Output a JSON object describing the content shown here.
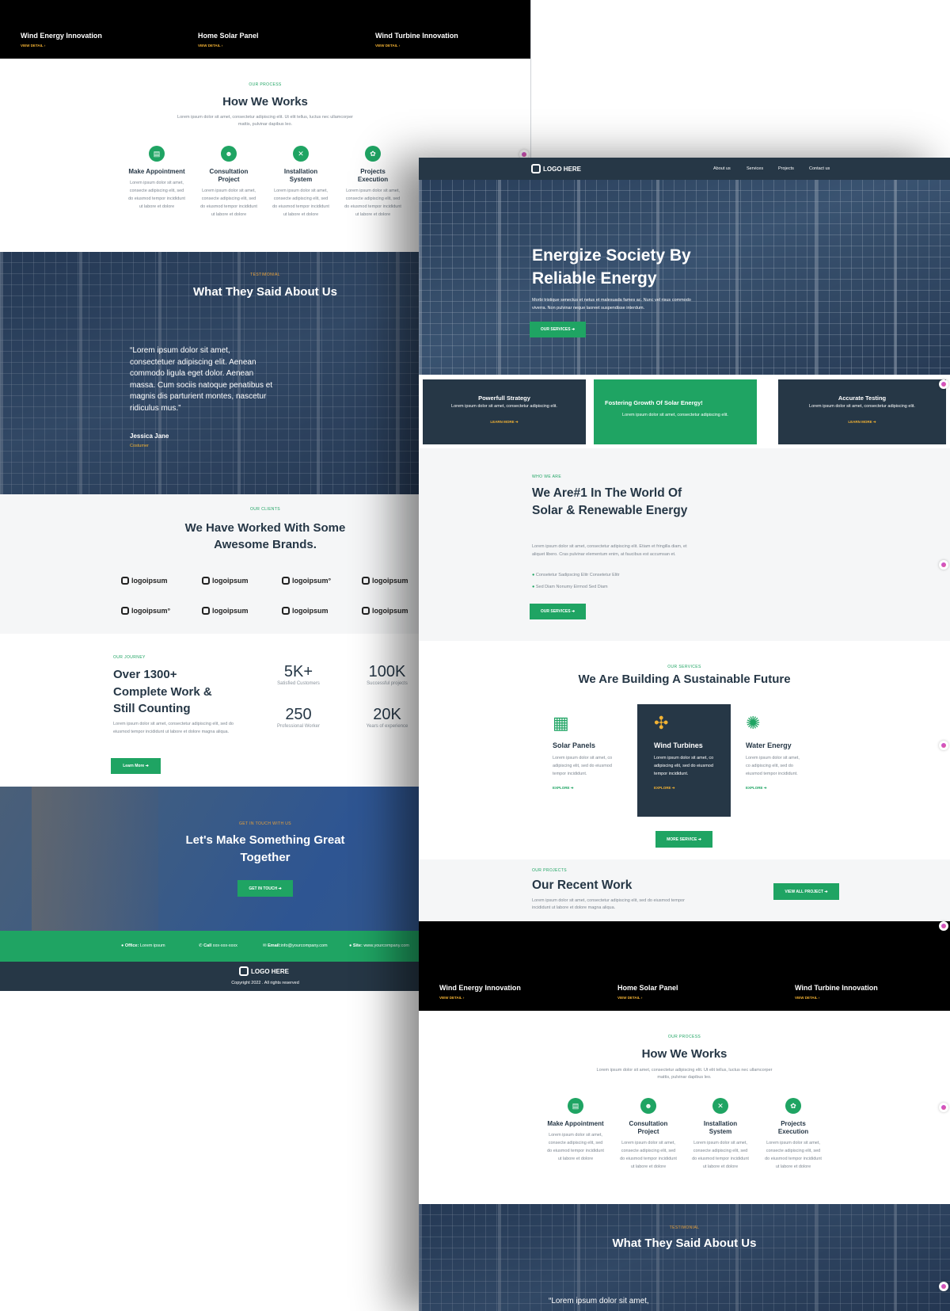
{
  "projects": [
    {
      "title": "Wind Energy Innovation",
      "link": "VIEW DETAIL ›"
    },
    {
      "title": "Home Solar Panel",
      "link": "VIEW DETAIL ›"
    },
    {
      "title": "Wind Turbine Innovation",
      "link": "VIEW DETAIL ›"
    }
  ],
  "process": {
    "eyebrow": "OUR PROCESS",
    "title": "How We Works",
    "desc": "Lorem ipsum dolor sit amet, consectetur adipiscing elit. Ut elit tellus, luctus nec ullamcorper mattis, pulvinar dapibus leo.",
    "steps": [
      {
        "icon": "calendar-icon",
        "glyph": "▤",
        "title": "Make Appointment",
        "desc": "Lorem ipsum dolor sit amet, consecte adipiscing elit, sed do eiusmod tempor incididunt ut labore et dolore"
      },
      {
        "icon": "users-icon",
        "glyph": "☻",
        "title": "Consultation Project",
        "desc": "Lorem ipsum dolor sit amet, consecte adipiscing elit, sed do eiusmod tempor incididunt ut labore et dolore"
      },
      {
        "icon": "tools-icon",
        "glyph": "✕",
        "title": "Installation System",
        "desc": "Lorem ipsum dolor sit amet, consecte adipiscing elit, sed do eiusmod tempor incididunt ut labore et dolore"
      },
      {
        "icon": "hand-plant-icon",
        "glyph": "✿",
        "title": "Projects Execution",
        "desc": "Lorem ipsum dolor sit amet, consecte adipiscing elit, sed do eiusmod tempor incididunt ut labore et dolore"
      }
    ]
  },
  "testimonial": {
    "eyebrow": "TESTIMONIAL",
    "title": "What They Said About Us",
    "quote": "“Lorem ipsum dolor sit amet, consectetuer adipiscing elit. Aenean commodo ligula eget dolor. Aenean massa. Cum sociis natoque penatibus et magnis dis parturient montes, nascetur ridiculus mus.”",
    "quote_short": "“Lorem ipsum dolor sit amet,",
    "name": "Jessica Jane",
    "role": "Costumer"
  },
  "clients": {
    "eyebrow": "OUR CLIENTS",
    "title": "We Have Worked With Some Awesome Brands.",
    "logos": [
      "logoipsum",
      "logoipsum",
      "logoipsum°",
      "logoipsum",
      "logoipsum°",
      "logoipsum",
      "logoipsum",
      "logoipsum"
    ]
  },
  "journey": {
    "eyebrow": "OUR JOURNEY",
    "title": "Over 1300+ Complete Work & Still Counting",
    "desc": "Lorem ipsum dolor sit amet, consectetur adipiscing elit, sed do eiusmod tempor incididunt ut labore et dolore magna aliqua.",
    "button": "Learn More ➔",
    "stats": [
      {
        "value": "5K+",
        "label": "Satisfied Customers"
      },
      {
        "value": "100K",
        "label": "Successful projects"
      },
      {
        "value": "250",
        "label": "Professional Worker"
      },
      {
        "value": "20K",
        "label": "Years of experience"
      }
    ]
  },
  "contact_cta": {
    "eyebrow": "GET IN TOUCH WITH US",
    "title": "Let's Make Something Great Together",
    "button": "GET IN TOUCH ➔"
  },
  "contact_bar": [
    {
      "label": "Office:",
      "value": "Lorem ipsum"
    },
    {
      "label": "Call",
      "value": "xxx-xxx-xxxx"
    },
    {
      "label": "Email:",
      "value": "info@yourcompany.com"
    },
    {
      "label": "Site:",
      "value": "www.yourcompany.com"
    }
  ],
  "footer": {
    "logo": "LOGO HERE",
    "copyright": "Copyright 2022 . All rights reserved"
  },
  "nav": {
    "logo": "LOGO HERE",
    "links": [
      "About us",
      "Services",
      "Projects",
      "Contact us"
    ]
  },
  "hero": {
    "title": "Energize Society By Reliable Energy",
    "desc": "Morbi tristique senectus et netus et malesuada fames ac. Nunc vel risus commodo viverra. Non pulvinar neque laoreet suspendisse interdum.",
    "button": "OUR SERVICES ➔"
  },
  "features": [
    {
      "title": "Powerfull Strategy",
      "desc": "Lorem ipsum dolor sit amet, consectetur adipiscing elit.",
      "link": "LEARN MORE ➔"
    },
    {
      "title": "Fostering Growth Of Solar Energy!",
      "desc": "Lorem ipsum dolor sit amet, consectetur adipiscing elit."
    },
    {
      "title": "Accurate Testing",
      "desc": "Lorem ipsum dolor sit amet, consectetur adipiscing elit.",
      "link": "LEARN MORE ➔"
    }
  ],
  "about": {
    "eyebrow": "WHO WE ARE",
    "title": "We Are#1 In The World Of Solar & Renewable Energy",
    "desc": "Lorem ipsum dolor sit amet, consectetur adipiscing elit. Etiam et fringilla diam, et aliquet libero. Cras pulvinar elementum enim, at faucibus est accumsan et.",
    "checks": [
      "Consetetur Sadipscing Elitr Consetetur Elitr",
      "Sed Diam Nonumy Eirmod Sed Diam"
    ],
    "button": "OUR SERVICES ➔"
  },
  "services": {
    "eyebrow": "OUR SERVICES",
    "title": "We Are Building A Sustainable Future",
    "items": [
      {
        "icon": "solar-panel-icon",
        "glyph": "▦",
        "title": "Solar Panels",
        "desc": "Lorem ipsum dolor sit amet, co adipiscing elit, sed do eiusmod tempor incididunt.",
        "link": "EXPLORE ➔"
      },
      {
        "icon": "windmill-icon",
        "glyph": "✣",
        "title": "Wind Turbines",
        "desc": "Lorem ipsum dolor sit amet, co adipiscing elit, sed do eiusmod tempor incididunt.",
        "link": "EXPLORE ➔"
      },
      {
        "icon": "energy-bolt-icon",
        "glyph": "✺",
        "title": "Water Energy",
        "desc": "Lorem ipsum dolor sit amet, co adipiscing elit, sed do eiusmod tempor incididunt.",
        "link": "EXPLORE ➔"
      }
    ],
    "button": "MORE SERVICE ➔"
  },
  "recent": {
    "eyebrow": "OUR PROJECTS",
    "title": "Our Recent Work",
    "desc": "Lorem ipsum dolor sit amet, consectetur adipiscing elit, sed do eiusmod tempor incididunt ut labore et dolore magna aliqua.",
    "button": "VIEW ALL PROJECT ➔"
  },
  "colors": {
    "green": "#1fa463",
    "navy": "#263746",
    "orange": "#f2b233"
  }
}
